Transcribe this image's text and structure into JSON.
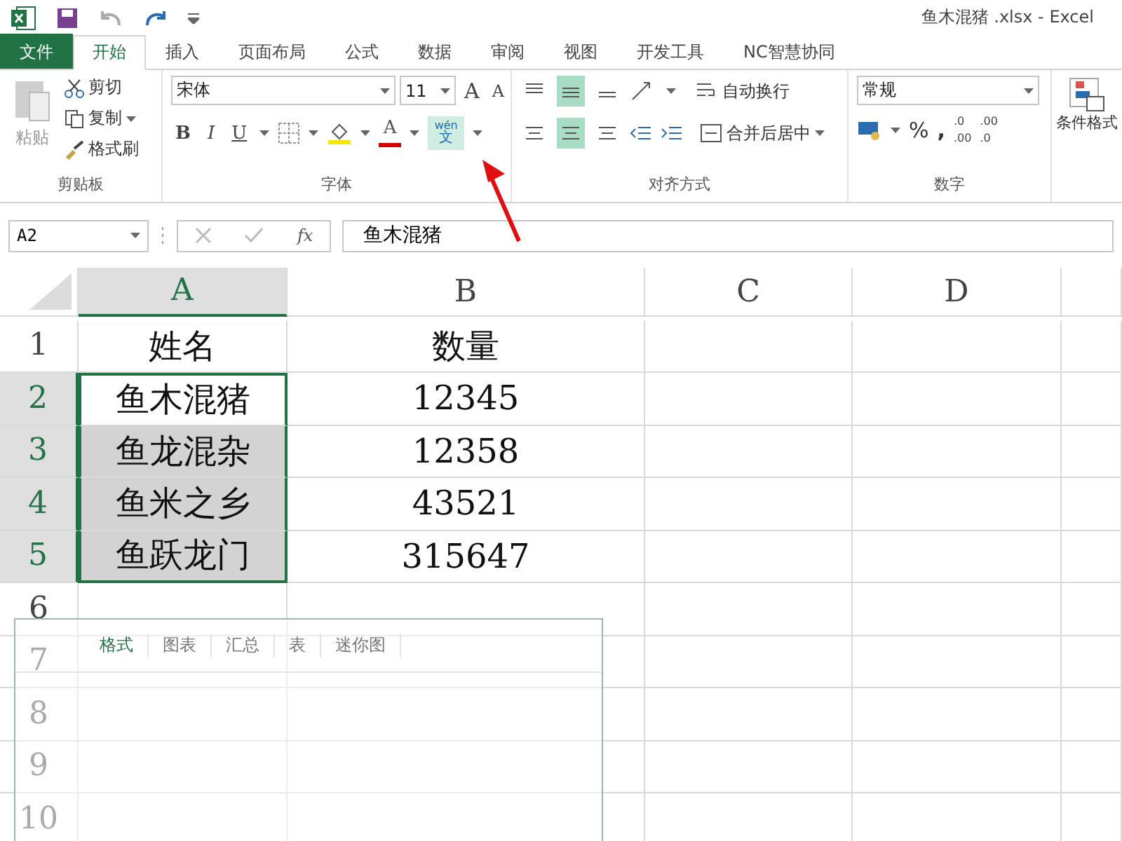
{
  "window": {
    "title": "鱼木混猪 .xlsx - Excel"
  },
  "ribbon_tabs": [
    {
      "label": "文件",
      "kind": "file",
      "selected": false
    },
    {
      "label": "开始",
      "kind": "tab",
      "selected": true
    },
    {
      "label": "插入",
      "kind": "tab",
      "selected": false
    },
    {
      "label": "页面布局",
      "kind": "tab",
      "selected": false
    },
    {
      "label": "公式",
      "kind": "tab",
      "selected": false
    },
    {
      "label": "数据",
      "kind": "tab",
      "selected": false
    },
    {
      "label": "审阅",
      "kind": "tab",
      "selected": false
    },
    {
      "label": "视图",
      "kind": "tab",
      "selected": false
    },
    {
      "label": "开发工具",
      "kind": "tab",
      "selected": false
    },
    {
      "label": "NC智慧协同",
      "kind": "tab",
      "selected": false
    }
  ],
  "clipboard": {
    "paste": "粘贴",
    "cut": "剪切",
    "copy": "复制",
    "format_painter": "格式刷",
    "label": "剪贴板"
  },
  "font": {
    "font_name": "宋体",
    "font_size": "11",
    "grow": "A",
    "shrink": "A",
    "bold": "B",
    "italic": "I",
    "underline": "U",
    "font_color": "A",
    "phonetic_top": "wén",
    "phonetic_bottom": "文",
    "label": "字体"
  },
  "alignment": {
    "wrap_text": "自动换行",
    "merge_center": "合并后居中",
    "label": "对齐方式"
  },
  "number": {
    "format": "常规",
    "percent": "%",
    "comma": ",",
    "increase_decimal": [
      ".0",
      ".00"
    ],
    "decrease_decimal": [
      ".00",
      ".0"
    ],
    "label": "数字"
  },
  "styles": {
    "conditional_format": "条件格式"
  },
  "formula_bar": {
    "name_box": "A2",
    "fx": "fx",
    "value": "鱼木混猪"
  },
  "columns": [
    {
      "label": "A",
      "selected": true
    },
    {
      "label": "B",
      "selected": false
    },
    {
      "label": "C",
      "selected": false
    },
    {
      "label": "D",
      "selected": false
    }
  ],
  "rows": [
    {
      "number": "1",
      "selected": false,
      "cells": [
        {
          "text": "姓名",
          "selected": false
        },
        {
          "text": "数量",
          "selected": false
        }
      ]
    },
    {
      "number": "2",
      "selected": true,
      "cells": [
        {
          "text": "鱼木混猪",
          "selected": true,
          "active": true
        },
        {
          "text": "12345",
          "selected": false
        }
      ]
    },
    {
      "number": "3",
      "selected": true,
      "cells": [
        {
          "text": "鱼龙混杂",
          "selected": true,
          "active": false
        },
        {
          "text": "12358",
          "selected": false
        }
      ]
    },
    {
      "number": "4",
      "selected": true,
      "cells": [
        {
          "text": "鱼米之乡",
          "selected": true,
          "active": false
        },
        {
          "text": "43521",
          "selected": false
        }
      ]
    },
    {
      "number": "5",
      "selected": true,
      "cells": [
        {
          "text": "鱼跃龙门",
          "selected": true,
          "active": false
        },
        {
          "text": "315647",
          "selected": false
        }
      ]
    },
    {
      "number": "6",
      "selected": false,
      "cells": []
    },
    {
      "number": "7",
      "selected": false,
      "cells": []
    },
    {
      "number": "8",
      "selected": false,
      "cells": []
    },
    {
      "number": "9",
      "selected": false,
      "cells": []
    },
    {
      "number": "10",
      "selected": false,
      "cells": []
    }
  ],
  "quick_analysis": {
    "tabs": [
      {
        "label": "格式",
        "selected": true
      },
      {
        "label": "图表",
        "selected": false
      },
      {
        "label": "汇总",
        "selected": false
      },
      {
        "label": "表",
        "selected": false
      },
      {
        "label": "迷你图",
        "selected": false
      }
    ]
  }
}
